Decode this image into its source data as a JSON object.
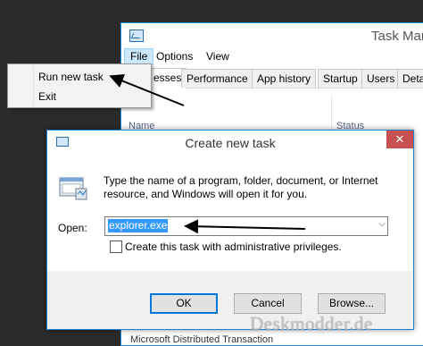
{
  "task_manager": {
    "title": "Task Mar",
    "menu": [
      "File",
      "Options",
      "View"
    ],
    "tabs": [
      "esses",
      "Performance",
      "App history",
      "Startup",
      "Users",
      "Deta"
    ],
    "column_name": "Name",
    "column_status": "Status",
    "row_partial": "Microsoft Distributed Transaction"
  },
  "file_menu": {
    "items": [
      "Run new task",
      "Exit"
    ]
  },
  "dialog": {
    "title": "Create new task",
    "close_glyph": "✕",
    "prompt": "Type the name of a program, folder, document, or Internet resource, and Windows will open it for you.",
    "open_label": "Open:",
    "open_value": "explorer.exe",
    "admin_checkbox_label": "Create this task with administrative privileges.",
    "admin_checked": false,
    "buttons": {
      "ok": "OK",
      "cancel": "Cancel",
      "browse": "Browse..."
    }
  },
  "watermark": "Deskmodder.de",
  "colors": {
    "accent_border": "#1883d7",
    "close_button": "#c75050",
    "selection": "#3399ff",
    "menu_highlight": "#cce8ff"
  },
  "icons": [
    "task-manager-icon",
    "run-dialog-icon",
    "run-program-icon",
    "combo-chevron-icon",
    "close-icon"
  ]
}
